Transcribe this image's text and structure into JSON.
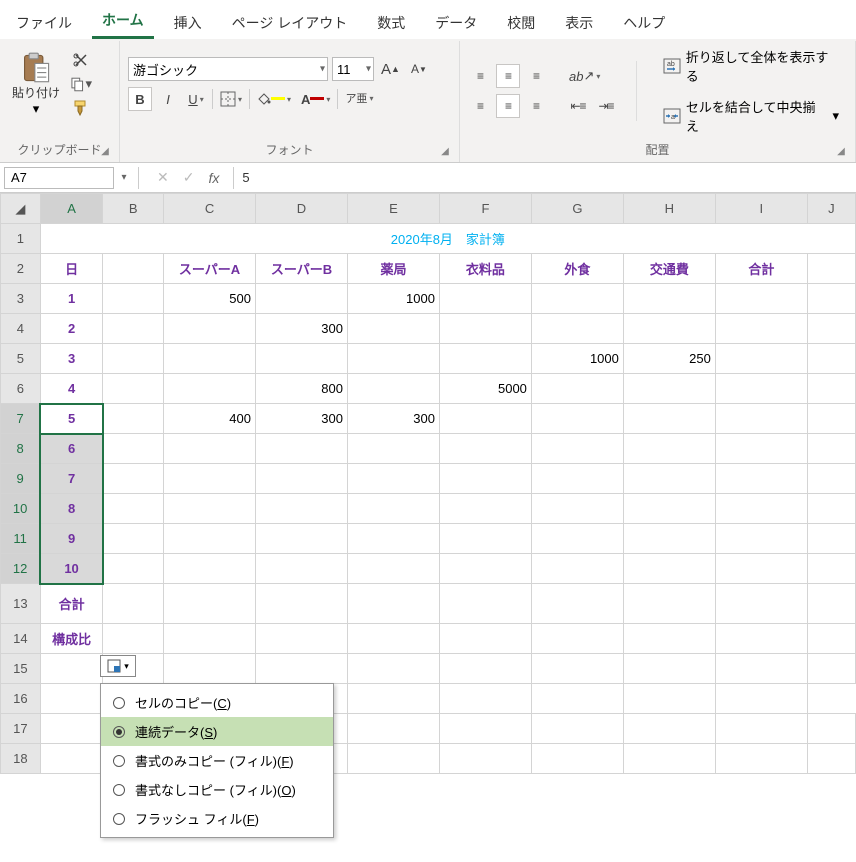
{
  "menu": [
    "ファイル",
    "ホーム",
    "挿入",
    "ページ レイアウト",
    "数式",
    "データ",
    "校閲",
    "表示",
    "ヘルプ"
  ],
  "menu_active_index": 1,
  "clipboard": {
    "paste_label": "貼り付け",
    "group_label": "クリップボード"
  },
  "font": {
    "name": "游ゴシック",
    "size": "11",
    "bold": "B",
    "italic": "I",
    "underline": "U",
    "ruby": "ア亜",
    "group_label": "フォント"
  },
  "alignment": {
    "wrap_label": "折り返して全体を表示する",
    "merge_label": "セルを結合して中央揃え",
    "group_label": "配置"
  },
  "namebox": "A7",
  "formula_value": "5",
  "columns": [
    "A",
    "B",
    "C",
    "D",
    "E",
    "F",
    "G",
    "H",
    "I",
    "J"
  ],
  "row_count": 18,
  "title": "2020年8月　家計簿",
  "row2": {
    "A": "日",
    "C": "スーパーA",
    "D": "スーパーB",
    "E": "薬局",
    "F": "衣料品",
    "G": "外食",
    "H": "交通費",
    "I": "合計"
  },
  "rows": [
    {
      "A": "1",
      "C": "500",
      "E": "1000"
    },
    {
      "A": "2",
      "D": "300"
    },
    {
      "A": "3",
      "G": "1000",
      "H": "250"
    },
    {
      "A": "4",
      "D": "800",
      "F": "5000"
    },
    {
      "A": "5",
      "C": "400",
      "D": "300",
      "E": "300"
    },
    {
      "A": "6"
    },
    {
      "A": "7"
    },
    {
      "A": "8"
    },
    {
      "A": "9"
    },
    {
      "A": "10"
    }
  ],
  "row13": {
    "A": "合計"
  },
  "row14": {
    "A": "構成比"
  },
  "autofill": {
    "options": [
      {
        "label": "セルのコピー(",
        "accel": "C",
        "suffix": ")"
      },
      {
        "label": "連続データ(",
        "accel": "S",
        "suffix": ")"
      },
      {
        "label": "書式のみコピー (フィル)(",
        "accel": "F",
        "suffix": ")"
      },
      {
        "label": "書式なしコピー (フィル)(",
        "accel": "O",
        "suffix": ")"
      },
      {
        "label": "フラッシュ フィル(",
        "accel": "F",
        "suffix": ")"
      }
    ],
    "selected_index": 1
  },
  "chart_data": {
    "type": "table",
    "title": "2020年8月　家計簿",
    "columns": [
      "日",
      "スーパーA",
      "スーパーB",
      "薬局",
      "衣料品",
      "外食",
      "交通費",
      "合計"
    ],
    "rows": [
      [
        1,
        500,
        null,
        1000,
        null,
        null,
        null,
        null
      ],
      [
        2,
        null,
        300,
        null,
        null,
        null,
        null,
        null
      ],
      [
        3,
        null,
        null,
        null,
        null,
        1000,
        250,
        null
      ],
      [
        4,
        null,
        800,
        null,
        5000,
        null,
        null,
        null
      ],
      [
        5,
        400,
        300,
        300,
        null,
        null,
        null,
        null
      ]
    ]
  }
}
